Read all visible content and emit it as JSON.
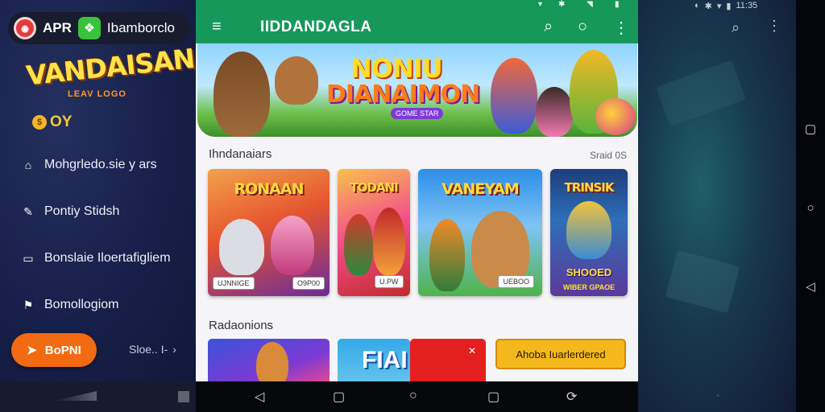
{
  "left_status": {
    "icons": [
      "signal-icon",
      "wifi-icon",
      "battery-icon"
    ]
  },
  "right_status": {
    "time": "11:35"
  },
  "drawer": {
    "app_abbr": "APR",
    "app_name": "Ibamborclo",
    "brand_title": "VANDAISAN",
    "brand_sub": "LEAV LOGO",
    "coins": "OY",
    "menu": [
      {
        "label": "Mohgrledo.sie y ars",
        "icon": "home-icon"
      },
      {
        "label": "Pontiy Stidsh",
        "icon": "edit-icon"
      },
      {
        "label": "Bonslaie Iloertafigliem",
        "icon": "wallet-icon"
      },
      {
        "label": "Bomollogiom",
        "icon": "flag-icon"
      }
    ],
    "cta_label": "BoPNI",
    "side_link": "Sloe.. I-"
  },
  "app": {
    "title": "IIDDANDAGLA",
    "banner_title": "NONIU",
    "banner_sub": "DIANAIMON",
    "banner_tag": "GOME STAR",
    "section1_title": "Ihndanaiars",
    "section1_link": "Sraid 0S",
    "cards": [
      {
        "title": "RONAAN",
        "badge_left": "UJNNIGE",
        "badge_right": "O9P00",
        "colors": [
          "#e6542f",
          "#6b2c9a"
        ]
      },
      {
        "title": "TODANI",
        "badge": "U.PW",
        "colors": [
          "#f24c8c",
          "#c12b2b"
        ]
      },
      {
        "title": "VANEYAM",
        "badge": "UEBOO",
        "colors": [
          "#2b8ee8",
          "#4fb34a"
        ]
      },
      {
        "title": "TRINSIK",
        "caption": "SHOOED",
        "sub": "WIBER GPAOE",
        "colors": [
          "#1d3e7a",
          "#5a3a9a"
        ]
      }
    ],
    "section2_title": "Radaonions",
    "promo_banner_text": "FIAI",
    "promo_button": "Ahoba Iuarlerdered"
  },
  "colors": {
    "accent": "#17985b",
    "cta": "#f26a12",
    "promo": "#f5b81c"
  }
}
